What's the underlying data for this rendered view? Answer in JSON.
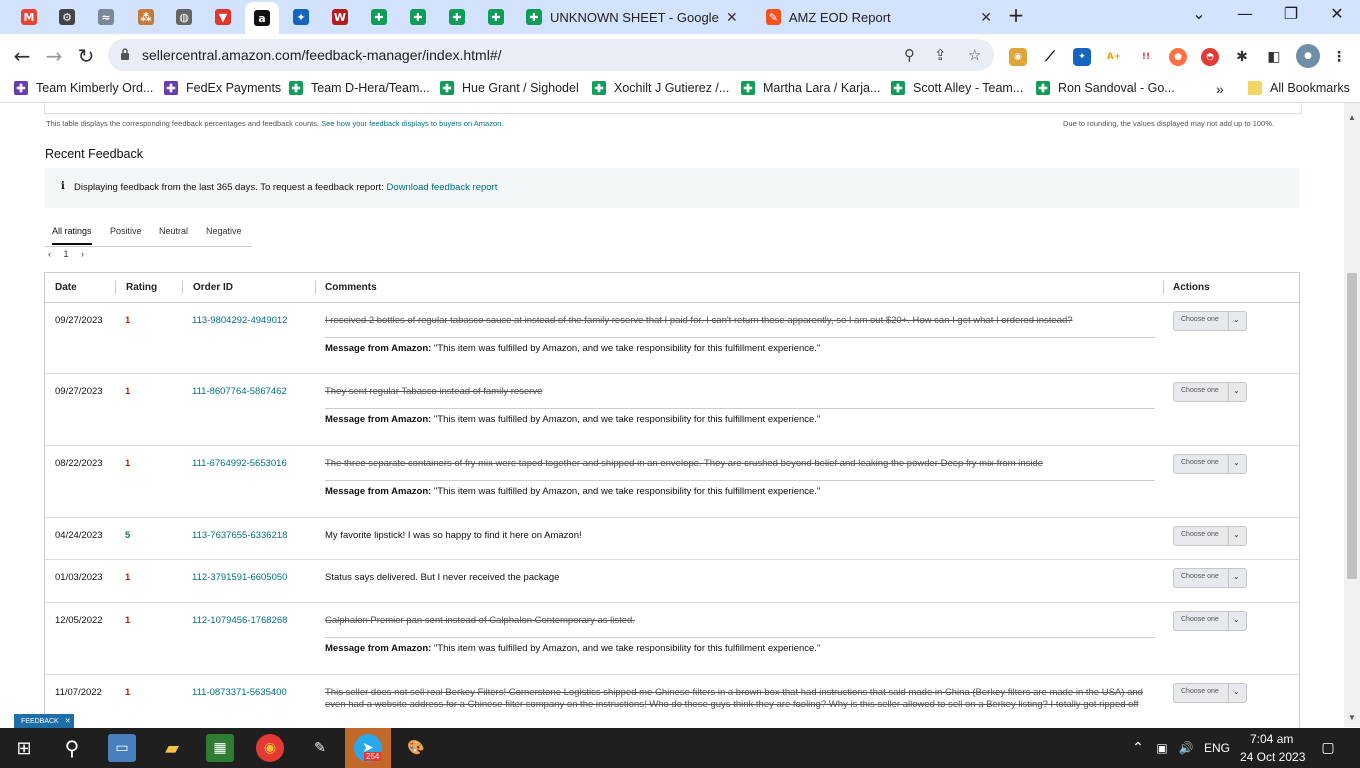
{
  "browser": {
    "tabs": [
      {
        "icon": "gmail-icon",
        "color": "#ea4335",
        "glyph": "M"
      },
      {
        "icon": "chatgpt-icon",
        "color": "#444",
        "glyph": "⚙"
      },
      {
        "icon": "app-icon",
        "color": "#7a8899",
        "glyph": "≈"
      },
      {
        "icon": "app-icon",
        "color": "#c47a3a",
        "glyph": "⁂"
      },
      {
        "icon": "globe-icon",
        "color": "#666",
        "glyph": "◍"
      },
      {
        "icon": "vidiq-icon",
        "color": "#e0362c",
        "glyph": "▼"
      },
      {
        "icon": "amazon-icon",
        "color": "#111",
        "glyph": "a"
      },
      {
        "icon": "helium10-icon",
        "color": "#1565c0",
        "glyph": "✦"
      },
      {
        "icon": "vw-icon",
        "color": "#b71c1c",
        "glyph": "W"
      },
      {
        "icon": "sheets-icon",
        "color": "#0f9d58",
        "glyph": "✚"
      },
      {
        "icon": "sheets-icon",
        "color": "#0f9d58",
        "glyph": "✚"
      },
      {
        "icon": "sheets-icon",
        "color": "#0f9d58",
        "glyph": "✚"
      },
      {
        "icon": "sheets-icon",
        "color": "#0f9d58",
        "glyph": "✚"
      }
    ],
    "wide_tabs": [
      {
        "title": "UNKNOWN SHEET - Google She",
        "color": "#0f9d58"
      },
      {
        "title": "AMZ EOD Report",
        "color": "#f4511e"
      }
    ],
    "url": "sellercentral.amazon.com/feedback-manager/index.html#/",
    "bookmarks": [
      {
        "label": "Team Kimberly Ord...",
        "color": "#673ab7"
      },
      {
        "label": "FedEx Payments",
        "color": "#673ab7"
      },
      {
        "label": "Team D-Hera/Team...",
        "color": "#0f9d58"
      },
      {
        "label": "Hue Grant / Sighodel",
        "color": "#0f9d58"
      },
      {
        "label": "Xochilt J Gutierez /...",
        "color": "#0f9d58"
      },
      {
        "label": "Martha Lara / Karja...",
        "color": "#0f9d58"
      },
      {
        "label": "Scott Alley - Team...",
        "color": "#0f9d58"
      },
      {
        "label": "Ron Sandoval - Go...",
        "color": "#0f9d58"
      }
    ],
    "all_bookmarks": "All Bookmarks",
    "more_bookmarks": "»"
  },
  "page": {
    "note_left": "This table displays the corresponding feedback percentages and feedback counts.",
    "note_link": "See how your feedback displays to buyers on Amazon.",
    "note_right": "Due to rounding, the values displayed may not add up to 100%.",
    "section_title": "Recent Feedback",
    "info_text": "Displaying feedback from the last 365 days. To request a feedback report:",
    "info_link": "Download feedback report",
    "rating_tabs": [
      "All ratings",
      "Positive",
      "Neutral",
      "Negative"
    ],
    "pager": {
      "prev": "‹",
      "page": "1",
      "next": "›"
    },
    "columns": [
      "Date",
      "Rating",
      "Order ID",
      "Comments",
      "Actions"
    ],
    "select_label": "Choose one",
    "amazon_msg_label": "Message from Amazon:",
    "amazon_msg_text": "\"This item was fulfilled by Amazon, and we take responsibility for this fulfillment experience.\"",
    "rows": [
      {
        "date": "09/27/2023",
        "rating": "1",
        "order": "113-9804292-4949012",
        "comment": "I received 2 bottles of regular tabasco sauce at instead of the family reserve that I paid for. I can't return these apparently, so I am out $20+. How can I get what I ordered instead?",
        "struck": true
      },
      {
        "date": "09/27/2023",
        "rating": "1",
        "order": "111-8607764-5867462",
        "comment": "They sent regular Tabasco instead of family reserve",
        "struck": true
      },
      {
        "date": "08/22/2023",
        "rating": "1",
        "order": "111-6764992-5653016",
        "comment": "The three separate containers of fry mix were taped together and shipped in an envelope. They are crushed beyond belief and leaking the powder Deep fry mix from inside",
        "struck": true
      },
      {
        "date": "04/24/2023",
        "rating": "5",
        "order": "113-7637655-6336218",
        "comment": "My favorite lipstick! I was so happy to find it here on Amazon!",
        "struck": false
      },
      {
        "date": "01/03/2023",
        "rating": "1",
        "order": "112-3791591-6605050",
        "comment": "Status says delivered. But I never received the package",
        "struck": false
      },
      {
        "date": "12/05/2022",
        "rating": "1",
        "order": "112-1079456-1768268",
        "comment": "Calphalon Premier pan sent instead of Calphalon Contemporary as listed.",
        "struck": true
      },
      {
        "date": "11/07/2022",
        "rating": "1",
        "order": "111-0873371-5635400",
        "comment": "This seller does not sell real Berkey Filters! Cornerstone Logistics shipped me Chinese filters in a brown box that had instructions that said made in China (Berkey filters are made in the USA) and even had a website address for a Chinese filter company on the instructions! Who do these guys think they are fooling? Why is this seller allowed to sell on a Berkey listing? I totally got ripped off",
        "struck": true
      }
    ],
    "feedback_tag": "FEEDBACK"
  },
  "taskbar": {
    "language": "ENG",
    "time": "7:04 am",
    "date": "24 Oct 2023",
    "telegram_badge": "254"
  }
}
